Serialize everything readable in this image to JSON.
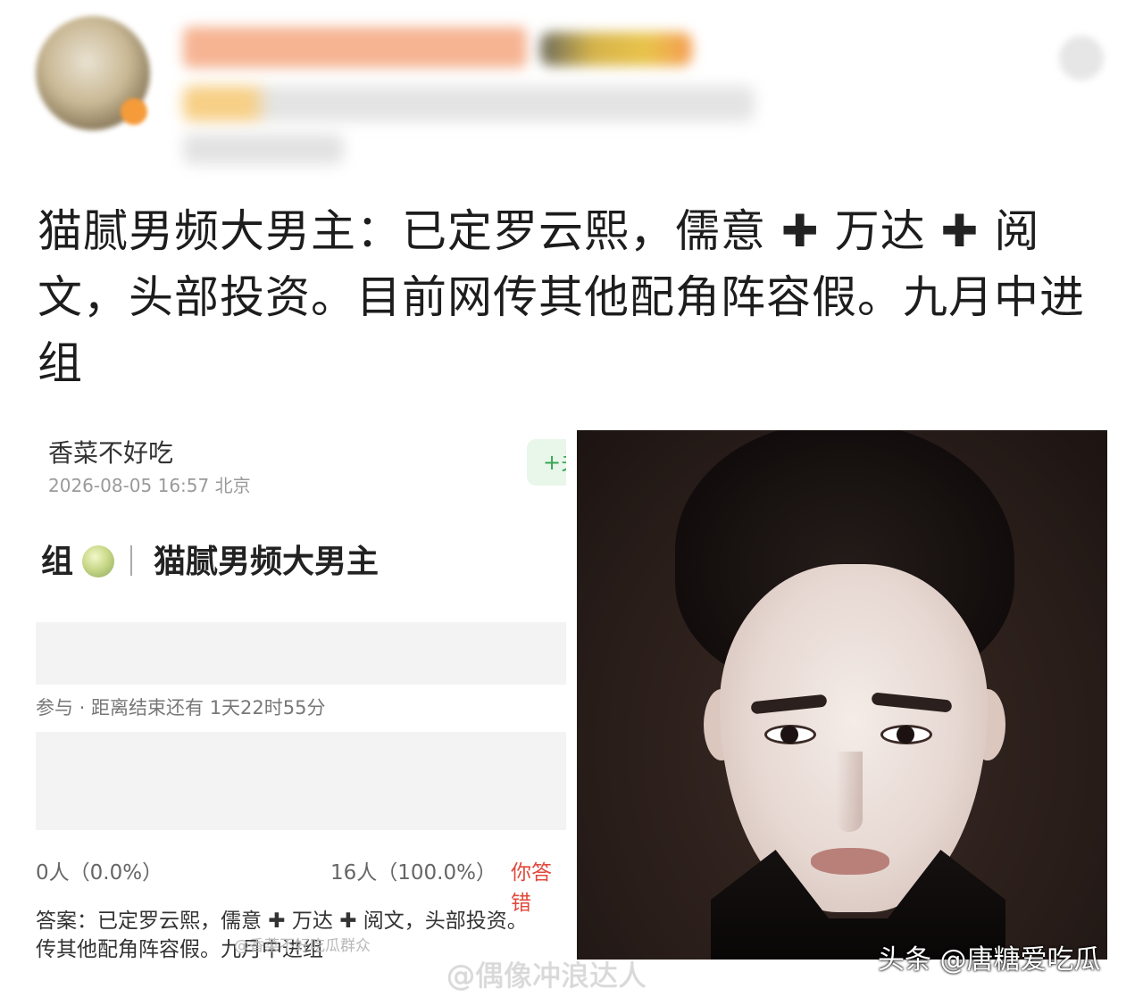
{
  "header": {
    "avatar_icon": "blurred-avatar-icon",
    "more_icon": "more-icon"
  },
  "post": {
    "line1a": "猫腻男频大男主：已定罗云熙，儒意",
    "plus1": "✚",
    "line1b": "万达",
    "plus2": "✚",
    "line1c": "阅",
    "line2": "文，头部投资。目前网传其他配角阵容假。九月中进",
    "line3": "组"
  },
  "screenshot": {
    "username": "香菜不好吃",
    "timestamp": "2026-08-05 16:57 北京",
    "follow_label": "+关",
    "title_prefix": "组",
    "title": "猫腻男频大男主",
    "poll_info": "参与 · 距离结束还有 1天22时55分",
    "option1": "0人（0.0%）",
    "option2": "16人（100.0%）",
    "option3": "你答错",
    "answer_line1": "答案：已定罗云熙，儒意 ✚ 万达 ✚ 阅文，头部投资。",
    "answer_line2": "传其他配角阵容假。九月中进组",
    "watermark_small": "@香菜不好吃瓜群众"
  },
  "watermarks": {
    "toutiao": "头条 @唐糖爱吃瓜",
    "weibo": "@偶像冲浪达人"
  }
}
